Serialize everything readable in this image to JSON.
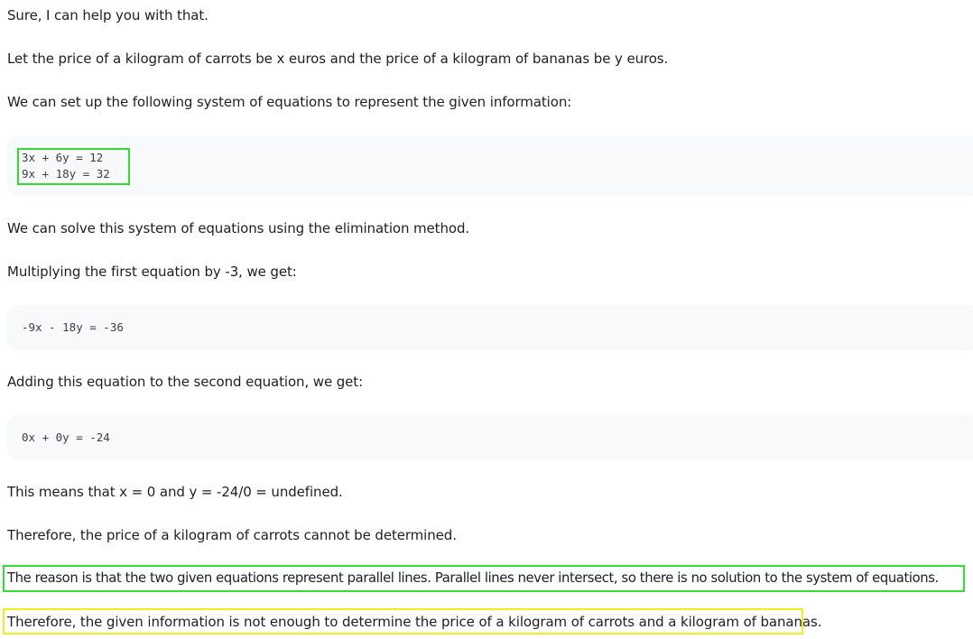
{
  "response": {
    "intro": "Sure, I can help you with that.",
    "define_vars": "Let the price of a kilogram of carrots be x euros and the price of a kilogram of bananas be y euros.",
    "setup": "We can set up the following system of equations to represent the given information:",
    "code1": [
      "3x + 6y = 12",
      "9x + 18y = 32"
    ],
    "solve_method": "We can solve this system of equations using the elimination method.",
    "multiply": "Multiplying the first equation by -3, we get:",
    "code2": [
      "-9x - 18y = -36"
    ],
    "adding": "Adding this equation to the second equation, we get:",
    "code3": [
      "0x + 0y = -24"
    ],
    "means": "This means that x = 0 and y = -24/0 = undefined.",
    "therefore1": "Therefore, the price of a kilogram of carrots cannot be determined.",
    "reason": "The reason is that the two given equations represent parallel lines. Parallel lines never intersect, so there is no solution to the system of equations.",
    "therefore2": "Therefore, the given information is not enough to determine the price of a kilogram of carrots and a kilogram of bananas."
  },
  "colors": {
    "highlight_green": "#33dd33",
    "highlight_yellow": "#eeee22",
    "code_background": "#f8f9fa"
  }
}
